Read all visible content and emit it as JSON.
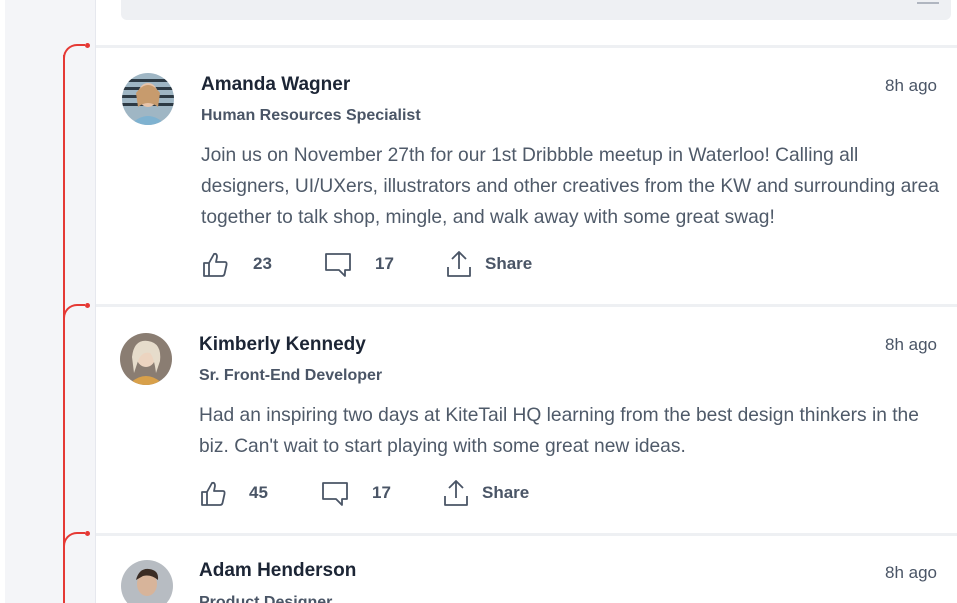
{
  "composer": {
    "placeholder": ""
  },
  "posts": [
    {
      "name": "Amanda Wagner",
      "role": "Human Resources Specialist",
      "time": "8h ago",
      "text": "Join us on November 27th for our 1st Dribbble meetup in Waterloo! Calling all designers, UI/UXers, illustrators and other creatives from the KW and surrounding area together to talk shop, mingle, and walk away with some great swag!",
      "likes": "23",
      "comments": "17",
      "share_label": "Share"
    },
    {
      "name": "Kimberly Kennedy",
      "role": "Sr. Front-End Developer",
      "time": "8h ago",
      "text": "Had an inspiring two days at KiteTail HQ learning from the best design thinkers in the biz. Can't wait to start playing with some great new ideas.",
      "likes": "45",
      "comments": "17",
      "share_label": "Share"
    },
    {
      "name": "Adam Henderson",
      "role": "Product Designer",
      "time": "8h ago"
    }
  ],
  "icons": {
    "like": "thumbs-up-icon",
    "comment": "comment-icon",
    "share": "share-upload-icon"
  },
  "colors": {
    "thread_line": "#e53935",
    "sidebar_bg": "#f4f5f8",
    "text_primary": "#1c2535",
    "text_secondary": "#4a5566"
  }
}
